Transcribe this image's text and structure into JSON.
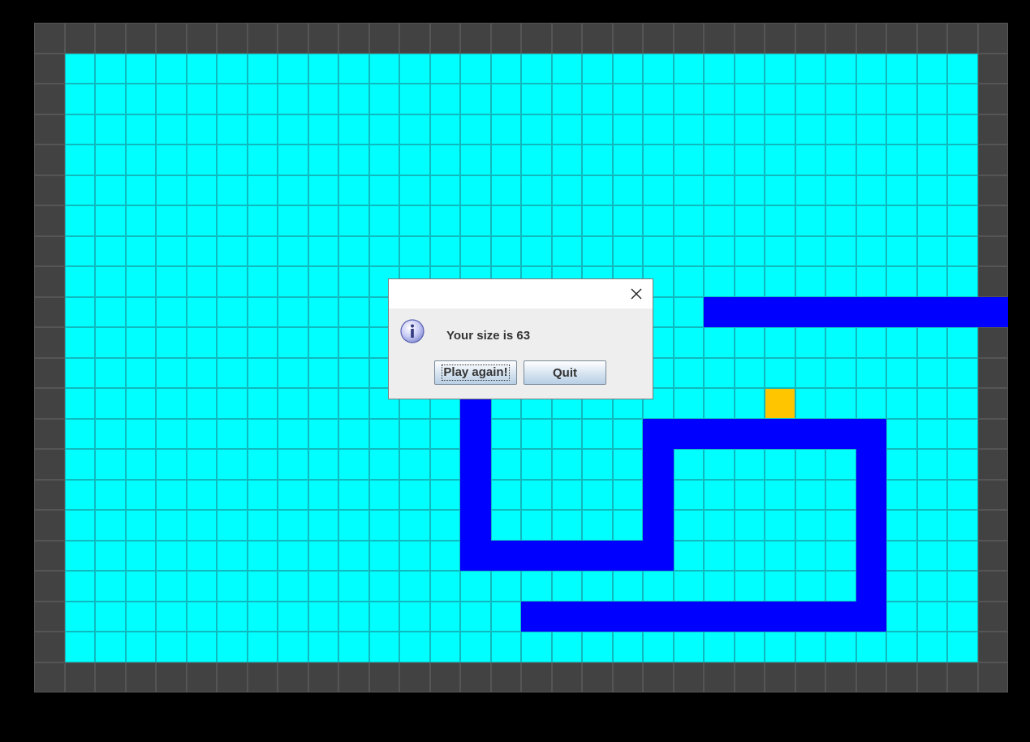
{
  "board": {
    "cols": 32,
    "rows": 22,
    "rows_layout": [
      "################################",
      "#..............................#",
      "#..............................#",
      "#..............................#",
      "#..............................#",
      "#..............................#",
      "#..............................#",
      "#..............................#",
      "#..............................#",
      "#.....................SSSSSSSSSS",
      "#..............................#",
      "#.............S................#",
      "#.............S.........F......#",
      "#.............S.....SSSSSSSS...#",
      "#.............S.....S......S...#",
      "#.............S.....S......S...#",
      "#.............S.....S......S...#",
      "#.............SSSSSSS......S...#",
      "#..........................S...#",
      "#...............SSSSSSSSSSSS...#",
      "#..............................#",
      "################################"
    ],
    "colors": {
      "wall": "#424242",
      "empty": "#00ffff",
      "snake": "#0000ff",
      "food": "#ffc600",
      "background": "#000000"
    }
  },
  "dialog": {
    "message": "Your size is 63",
    "icon": "info-icon",
    "close_icon": "close-icon",
    "buttons": {
      "play_again": "Play again!",
      "quit": "Quit"
    }
  }
}
